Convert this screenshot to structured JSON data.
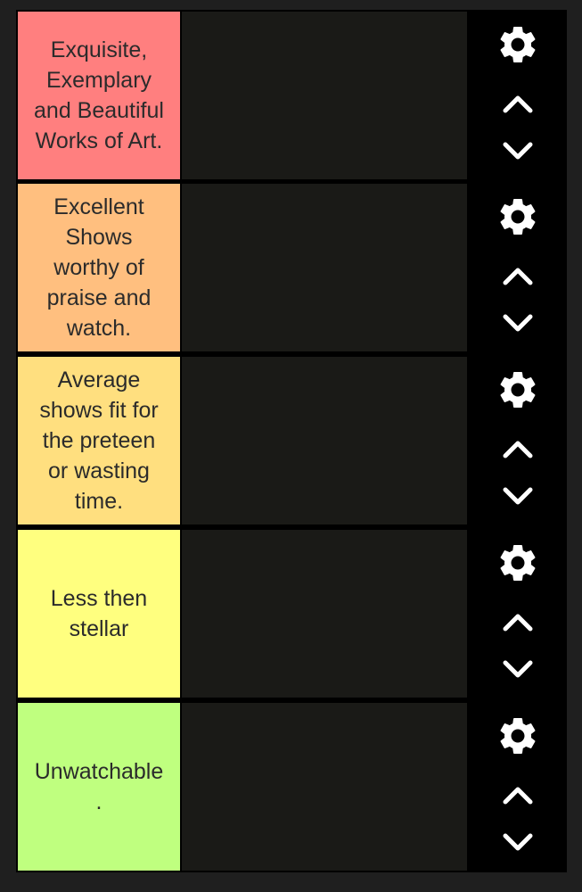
{
  "tiers": [
    {
      "label": "Exquisite,\nExemplary\nand Beautiful\nWorks of Art.",
      "color": "#ff7f7f",
      "settings_icon": "gear-icon",
      "move_up_icon": "chevron-up-icon",
      "move_down_icon": "chevron-down-icon"
    },
    {
      "label": "Excellent\nShows\nworthy of\npraise and\nwatch.",
      "color": "#ffbf7f",
      "settings_icon": "gear-icon",
      "move_up_icon": "chevron-up-icon",
      "move_down_icon": "chevron-down-icon"
    },
    {
      "label": "Average\nshows fit for\nthe preteen\nor wasting\ntime.",
      "color": "#ffdf7f",
      "settings_icon": "gear-icon",
      "move_up_icon": "chevron-up-icon",
      "move_down_icon": "chevron-down-icon"
    },
    {
      "label": "Less then\nstellar",
      "color": "#ffff7f",
      "settings_icon": "gear-icon",
      "move_up_icon": "chevron-up-icon",
      "move_down_icon": "chevron-down-icon"
    },
    {
      "label": "Unwatchable\n.",
      "color": "#bfff7f",
      "settings_icon": "gear-icon",
      "move_up_icon": "chevron-up-icon",
      "move_down_icon": "chevron-down-icon"
    }
  ],
  "theme": {
    "background": "#1f1f1f",
    "drop_area": "#1a1a17",
    "controls": "#000000",
    "icon_color": "#ffffff"
  }
}
